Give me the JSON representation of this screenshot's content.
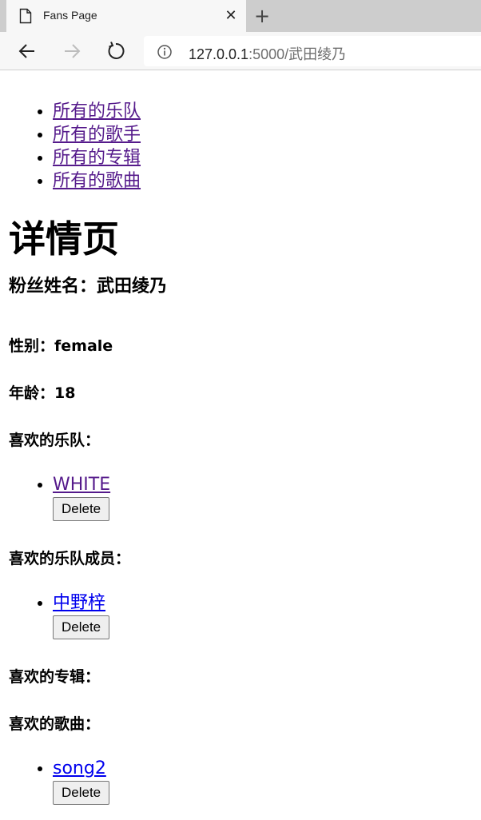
{
  "browser": {
    "tab_title": "Fans Page",
    "url_host": "127.0.0.1",
    "url_rest": ":5000/武田绫乃"
  },
  "nav": {
    "items": [
      "所有的乐队",
      "所有的歌手",
      "所有的专辑",
      "所有的歌曲"
    ]
  },
  "page": {
    "heading": "详情页",
    "fan_name": "粉丝姓名：武田绫乃",
    "gender": "性别：female",
    "age": "年龄：18"
  },
  "sections": {
    "bands": {
      "label": "喜欢的乐队：",
      "items": [
        "WHITE"
      ]
    },
    "members": {
      "label": "喜欢的乐队成员：",
      "items": [
        "中野梓"
      ]
    },
    "albums": {
      "label": "喜欢的专辑：",
      "items": []
    },
    "songs": {
      "label": "喜欢的歌曲：",
      "items": [
        "song2"
      ]
    },
    "delete_label": "Delete"
  }
}
